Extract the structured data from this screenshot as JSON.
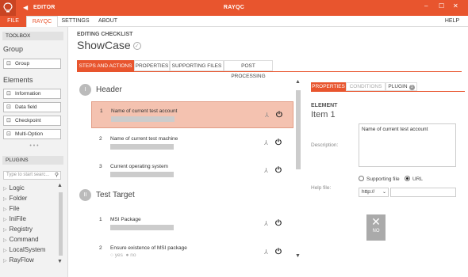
{
  "title": {
    "editor": "EDITOR",
    "app": "RAYQC"
  },
  "menu": {
    "file": "FILE",
    "rayqc": "RAYQC",
    "settings": "SETTINGS",
    "about": "ABOUT",
    "help": "HELP"
  },
  "toolbox": {
    "header": "TOOLBOX",
    "group_heading": "Group",
    "group_button": "Group",
    "elements_heading": "Elements",
    "elements": [
      "Information",
      "Data field",
      "Checkpoint",
      "Multi-Option"
    ],
    "more": "• • •"
  },
  "plugins": {
    "header": "PLUGINS",
    "search_placeholder": "Type to start searc...",
    "items": [
      "Logic",
      "Folder",
      "File",
      "IniFile",
      "Registry",
      "Command",
      "LocalSystem",
      "RayFlow"
    ]
  },
  "main": {
    "editing_label": "EDITING CHECKLIST",
    "checklist_name": "ShowCase",
    "tabs": [
      "STEPS AND ACTIONS",
      "PROPERTIES",
      "SUPPORTING FILES",
      "POST PROCESSING"
    ]
  },
  "sections": [
    {
      "num": "I",
      "title": "Header",
      "steps": [
        {
          "num": "1",
          "name": "Name of current test account"
        },
        {
          "num": "2",
          "name": "Name of current test machine"
        },
        {
          "num": "3",
          "name": "Current operating system"
        }
      ]
    },
    {
      "num": "II",
      "title": "Test Target",
      "steps": [
        {
          "num": "1",
          "name": "MSI Package"
        },
        {
          "num": "2",
          "name": "Ensure existence of MSI package",
          "yes": "yes",
          "no": "no"
        }
      ]
    }
  ],
  "props": {
    "tabs": [
      "PROPERTIES",
      "CONDITIONS",
      "PLUGIN"
    ],
    "plugin_badge": "1",
    "element_label": "ELEMENT",
    "item": "Item 1",
    "description_label": "Description:",
    "description_value": "Name of current test account",
    "help_file_label": "Help file:",
    "supporting_file": "Supporting file",
    "url": "URL",
    "protocol": "http://",
    "no_button": "NO"
  }
}
